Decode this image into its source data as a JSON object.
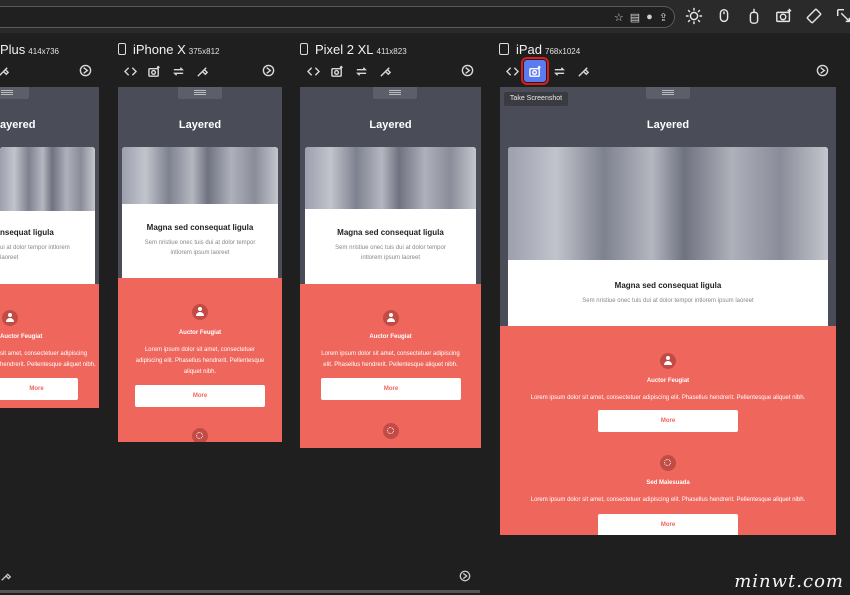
{
  "browser": {
    "url_icons": [
      "star-icon",
      "database-icon",
      "color-icon",
      "share-icon"
    ],
    "tool_icons": [
      "brightness-icon",
      "mouse-icon",
      "keyboard-icon",
      "camera-add-icon",
      "rotate-icon",
      "pointer-icon",
      "touch-icon"
    ]
  },
  "devices": [
    {
      "name": "Plus",
      "size": "414x736"
    },
    {
      "name": "iPhone X",
      "size": "375x812"
    },
    {
      "name": "Pixel 2 XL",
      "size": "411x823"
    },
    {
      "name": "iPad",
      "size": "768x1024"
    }
  ],
  "tooltip": "Take Screenshot",
  "site": {
    "header": "Layered",
    "card_title": "Magna sed consequat ligula",
    "card_sub_line1": "Sem nristiue onec tuis dui at dolor tempor",
    "card_sub_line2": "intlorem ipsum laoreet",
    "card_sub_full": "Sem nristiue onec tuis dui at dolor tempor intlorem ipsum laoreet",
    "plus_card_title": "nsequat ligula",
    "plus_card_sub1": "ui at dolor tempor intlorem",
    "plus_card_sub2": "laoreet",
    "author": "Auctor Feugiat",
    "body_line1": "Lorem ipsum dolor sit amet, consectetuer",
    "body_line2": "adipiscing elit. Phasellus hendrerit. Pellentesque",
    "body_line3": "aliquet nibh.",
    "body_full": "Lorem ipsum dolor sit amet, consectetuer adipiscing elit. Phasellus hendrerit. Pellentesque aliquet nibh.",
    "pixel_body1": "Lorem ipsum dolor sit amet, consectetuer adipiscing",
    "pixel_body2": "elit. Phasellus hendrerit. Pellentesque aliquet nibh.",
    "plus_body1": "sit amet, consectetuer adipiscing",
    "plus_body2": "hendrerit. Pellentesque aliquet nibh.",
    "plus_header": "ayered",
    "plus_button": "More",
    "button": "More",
    "section2": "Sed Malesuada"
  },
  "watermark": "minwt.com",
  "colors": {
    "accent": "#5a7cf0",
    "coral": "#ef665c",
    "highlight": "#e01b1b"
  }
}
